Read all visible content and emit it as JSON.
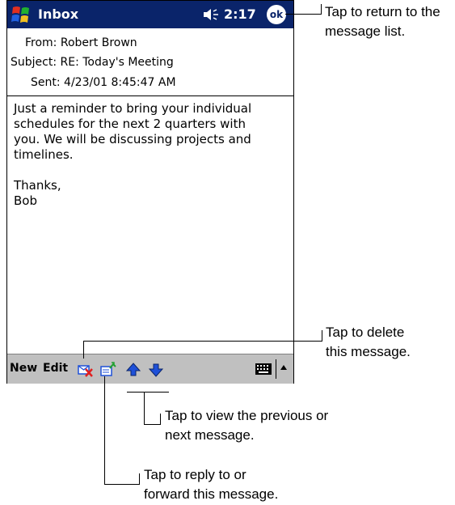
{
  "titlebar": {
    "app_title": "Inbox",
    "time": "2:17",
    "ok_label": "ok",
    "icons": [
      "windows-start-icon",
      "speaker-icon"
    ]
  },
  "message": {
    "from_label": "From:",
    "from_value": "Robert Brown",
    "subject_label": "Subject:",
    "subject_value": "RE: Today's Meeting",
    "sent_label": "Sent:",
    "sent_value": "4/23/01 8:45:47 AM",
    "body": "Just a reminder to bring your individual\nschedules for the next 2 quarters with\nyou. We will be discussing projects and\ntimelines.\n\nThanks,\nBob"
  },
  "menubar": {
    "new_label": "New",
    "edit_label": "Edit",
    "icons": [
      "delete-icon",
      "reply-icon",
      "previous-arrow-icon",
      "next-arrow-icon",
      "keyboard-icon",
      "input-menu-arrow-icon"
    ]
  },
  "callouts": {
    "ok_line1": "Tap to return to the",
    "ok_line2": "message list.",
    "delete_line1": "Tap to delete",
    "delete_line2": "this message.",
    "nav_line1": "Tap to view the previous or",
    "nav_line2": "next message.",
    "reply_line1": "Tap to reply to or",
    "reply_line2": "forward this message."
  },
  "colors": {
    "titlebar": "#0a246a",
    "menubar": "#c0c0c0",
    "delete_red": "#e02020",
    "arrow_blue": "#1e50d8"
  }
}
